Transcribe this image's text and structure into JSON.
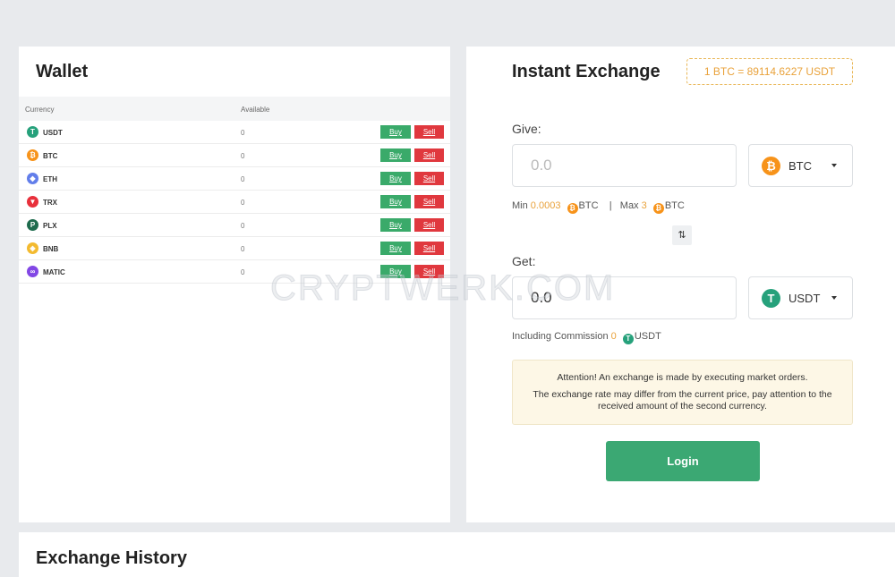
{
  "wallet": {
    "title": "Wallet",
    "columns": {
      "currency": "Currency",
      "available": "Available"
    },
    "buy_label": "Buy",
    "sell_label": "Sell",
    "items": [
      {
        "symbol": "USDT",
        "available": "0",
        "icon": "tether-icon",
        "color": "#26a17b",
        "glyph": "T"
      },
      {
        "symbol": "BTC",
        "available": "0",
        "icon": "bitcoin-icon",
        "color": "#f7931a",
        "glyph": "₿"
      },
      {
        "symbol": "ETH",
        "available": "0",
        "icon": "ethereum-icon",
        "color": "#627eea",
        "glyph": "◆"
      },
      {
        "symbol": "TRX",
        "available": "0",
        "icon": "tron-icon",
        "color": "#e8303b",
        "glyph": "▼"
      },
      {
        "symbol": "PLX",
        "available": "0",
        "icon": "plx-icon",
        "color": "#1e6b4d",
        "glyph": "P"
      },
      {
        "symbol": "BNB",
        "available": "0",
        "icon": "bnb-icon",
        "color": "#f3ba2f",
        "glyph": "◈"
      },
      {
        "symbol": "MATIC",
        "available": "0",
        "icon": "matic-icon",
        "color": "#8247e5",
        "glyph": "∞"
      }
    ]
  },
  "exchange": {
    "title": "Instant Exchange",
    "rate": "1 BTC = 89114.6227 USDT",
    "give_label": "Give:",
    "give_placeholder": "0.0",
    "give_currency": "BTC",
    "min_label": "Min",
    "min_value": "0.0003",
    "max_label": "Max",
    "max_value": "3",
    "limit_currency": "BTC",
    "separator": "|",
    "get_label": "Get:",
    "get_value": "0.0",
    "get_currency": "USDT",
    "commission_label": "Including Commission",
    "commission_value": "0",
    "commission_currency": "USDT",
    "notice_line1": "Attention! An exchange is made by executing market orders.",
    "notice_line2": "The exchange rate may differ from the current price, pay attention to the received amount of the second currency.",
    "login_label": "Login"
  },
  "history": {
    "title": "Exchange History"
  },
  "watermark": "CRYPTWERK.COM",
  "colors": {
    "accent_green": "#3ba873",
    "sell_red": "#e0383e",
    "highlight_orange": "#e9a23b"
  }
}
